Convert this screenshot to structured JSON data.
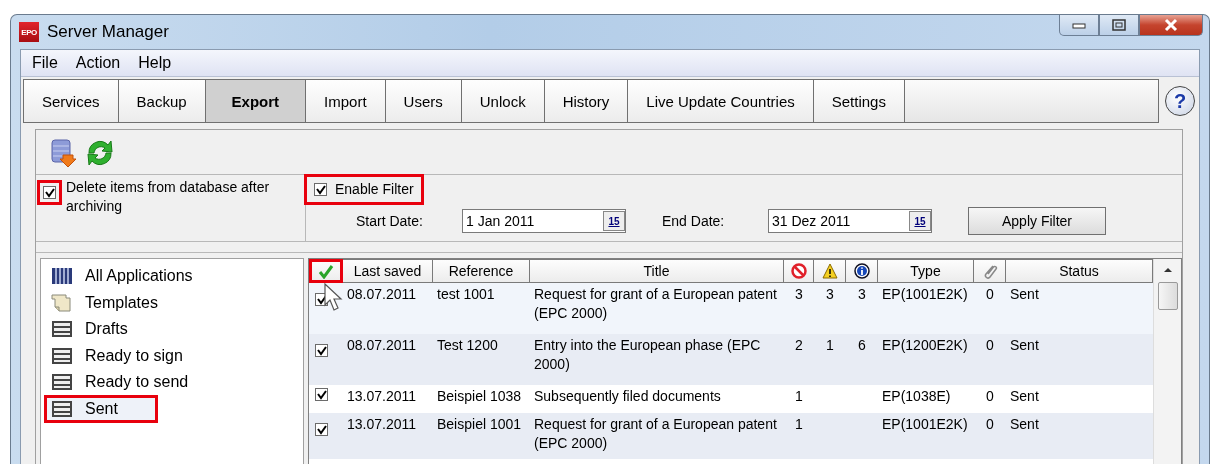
{
  "window": {
    "title": "Server Manager",
    "app_icon": "EPO"
  },
  "menu": [
    "File",
    "Action",
    "Help"
  ],
  "tabs": [
    {
      "label": "Services",
      "selected": false
    },
    {
      "label": "Backup",
      "selected": false
    },
    {
      "label": "Export",
      "selected": true
    },
    {
      "label": "Import",
      "selected": false
    },
    {
      "label": "Users",
      "selected": false
    },
    {
      "label": "Unlock",
      "selected": false
    },
    {
      "label": "History",
      "selected": false
    },
    {
      "label": "Live Update Countries",
      "selected": false
    },
    {
      "label": "Settings",
      "selected": false
    }
  ],
  "help_button": "?",
  "archive_option": {
    "label": "Delete items from database after archiving",
    "checked": true,
    "highlighted": true
  },
  "filter": {
    "label": "Enable Filter",
    "checked": true,
    "highlighted": true,
    "start_label": "Start Date:",
    "start_value": "1 Jan 2011",
    "end_label": "End Date:",
    "end_value": "31 Dez 2011",
    "start_calendar_button": "15",
    "end_calendar_button": "15",
    "apply_button": "Apply Filter"
  },
  "sidebar": {
    "items": [
      {
        "label": "All Applications",
        "kind": "all",
        "selected": false,
        "highlighted": false
      },
      {
        "label": "Templates",
        "kind": "template",
        "selected": false,
        "highlighted": false
      },
      {
        "label": "Drafts",
        "kind": "folder",
        "selected": false,
        "highlighted": false
      },
      {
        "label": "Ready to sign",
        "kind": "folder",
        "selected": false,
        "highlighted": false
      },
      {
        "label": "Ready to send",
        "kind": "folder",
        "selected": false,
        "highlighted": false
      },
      {
        "label": "Sent",
        "kind": "folder",
        "selected": true,
        "highlighted": true
      }
    ]
  },
  "table": {
    "select_all": {
      "highlighted": true
    },
    "columns": [
      {
        "kind": "text",
        "label": "Last saved"
      },
      {
        "kind": "text",
        "label": "Reference"
      },
      {
        "kind": "text",
        "label": "Title"
      },
      {
        "kind": "error"
      },
      {
        "kind": "warning"
      },
      {
        "kind": "info"
      },
      {
        "kind": "text",
        "label": "Type"
      },
      {
        "kind": "attachment"
      },
      {
        "kind": "text",
        "label": "Status"
      }
    ],
    "rows": [
      {
        "checked": true,
        "cells": [
          "08.07.2011",
          "test 1001",
          "Request for grant of a European patent (EPC 2000)",
          "3",
          "3",
          "3",
          "EP(1001E2K)",
          "0",
          "Sent"
        ]
      },
      {
        "checked": true,
        "cells": [
          "08.07.2011",
          "Test 1200",
          "Entry into the European phase (EPC 2000)",
          "2",
          "1",
          "6",
          "EP(1200E2K)",
          "0",
          "Sent"
        ]
      },
      {
        "checked": true,
        "cells": [
          "13.07.2011",
          "Beispiel 1038",
          "Subsequently filed documents",
          "1",
          null,
          null,
          "EP(1038E)",
          "0",
          "Sent"
        ]
      },
      {
        "checked": true,
        "cells": [
          "13.07.2011",
          "Beispiel 1001",
          "Request for grant of a European patent (EPC 2000)",
          "1",
          null,
          null,
          "EP(1001E2K)",
          "0",
          "Sent"
        ]
      }
    ]
  }
}
